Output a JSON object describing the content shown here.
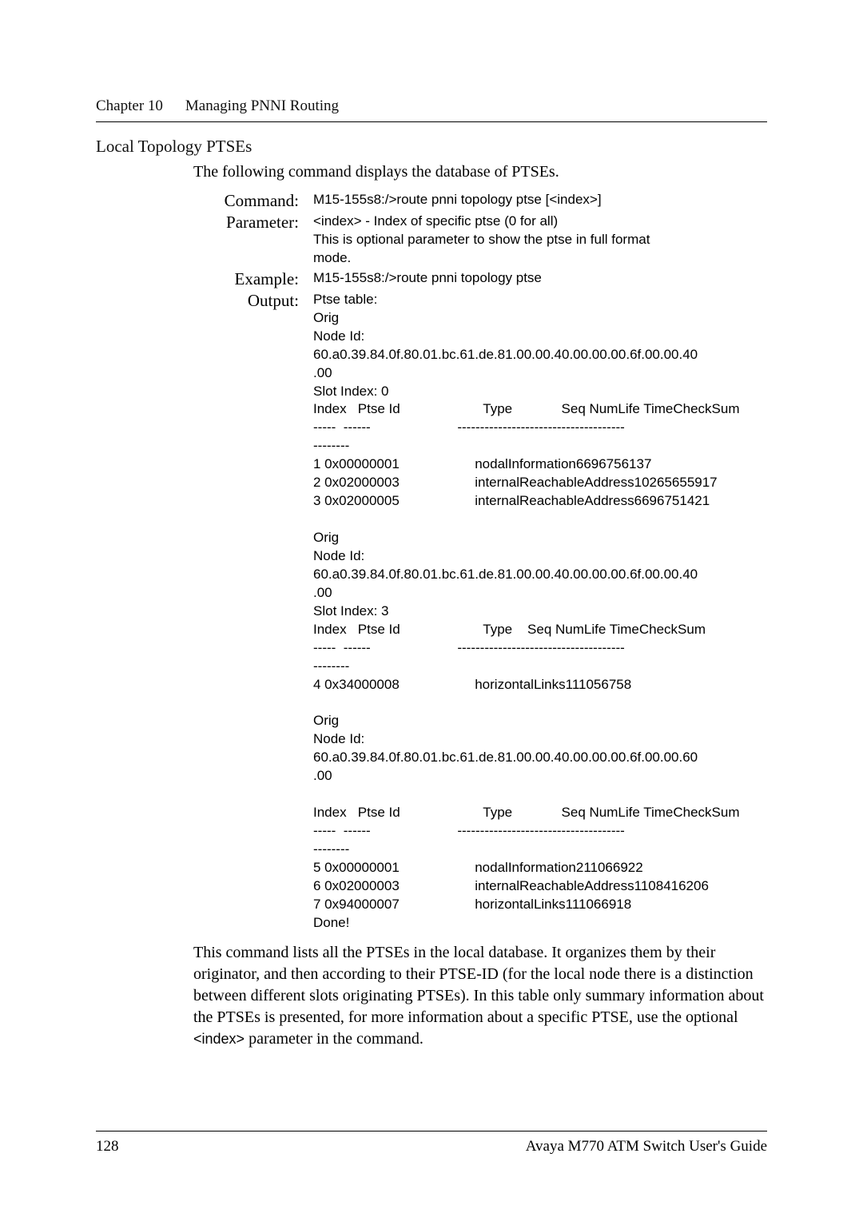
{
  "chapter": {
    "label": "Chapter 10",
    "title": "Managing PNNI Routing"
  },
  "section": "Local Topology PTSEs",
  "intro": "The following command displays the database of PTSEs.",
  "command": {
    "label": "Command:",
    "value": "M15-155s8:/>route pnni topology ptse [<index>]"
  },
  "parameter": {
    "label": "Parameter:",
    "value": "<index> - Index of specific ptse (0 for all)\nThis is optional parameter to show the ptse in full format\nmode."
  },
  "example": {
    "label": "Example:",
    "value": "M15-155s8:/>route pnni topology ptse"
  },
  "output": {
    "label": "Output:",
    "block": "Ptse table:\nOrig\nNode Id:\n60.a0.39.84.0f.80.01.bc.61.de.81.00.00.40.00.00.00.6f.00.00.40\n.00\nSlot Index: 0\nIndex   Ptse Id                      Type             Seq NumLife TimeCheckSum\n-----  ------                       -------------------------------------\n--------\n1 0x00000001                    nodalInformation6696756137\n2 0x02000003                    internalReachableAddress10265655917\n3 0x02000005                    internalReachableAddress6696751421\n\nOrig\nNode Id:\n60.a0.39.84.0f.80.01.bc.61.de.81.00.00.40.00.00.00.6f.00.00.40\n.00\nSlot Index: 3\nIndex   Ptse Id                      Type    Seq NumLife TimeCheckSum\n-----  ------                       -------------------------------------\n--------\n4 0x34000008                    horizontalLinks111056758\n\nOrig\nNode Id:\n60.a0.39.84.0f.80.01.bc.61.de.81.00.00.40.00.00.00.6f.00.00.60\n.00\n\nIndex   Ptse Id                      Type             Seq NumLife TimeCheckSum\n-----  ------                       -------------------------------------\n--------\n5 0x00000001                    nodalInformation211066922\n6 0x02000003                    internalReachableAddress1108416206\n7 0x94000007                    horizontalLinks111066918\nDone!"
  },
  "closing_parts": {
    "p1": "This command lists all the PTSEs in the local database. It organizes them by their originator, and then according to their PTSE-ID (for the local node there is a distinction between different slots originating PTSEs). In this table only summary information about the PTSEs is presented, for more information about a specific PTSE, use the optional ",
    "code": "<index>",
    "p2": "  parameter in the command."
  },
  "footer": {
    "page": "128",
    "book": "Avaya M770 ATM Switch User's Guide"
  }
}
